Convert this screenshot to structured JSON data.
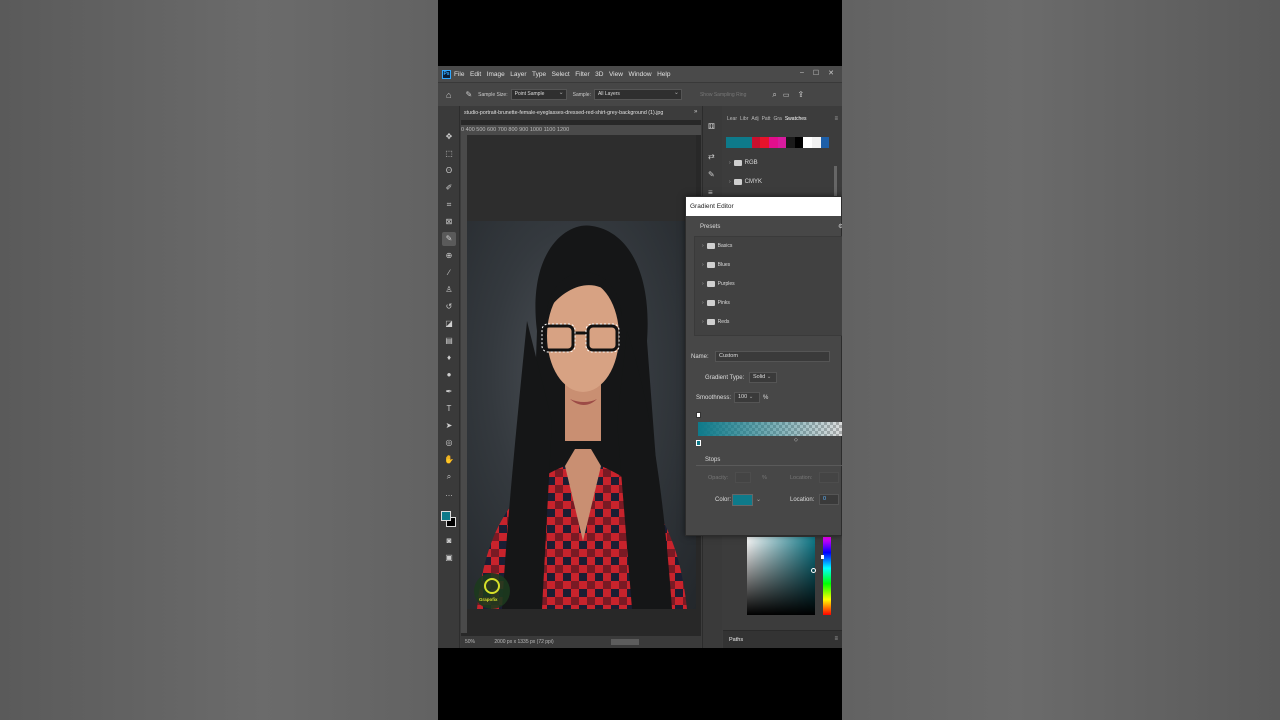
{
  "menu": {
    "items": [
      "File",
      "Edit",
      "Image",
      "Layer",
      "Type",
      "Select",
      "Filter",
      "3D",
      "View",
      "Window",
      "Help"
    ],
    "win_controls": [
      "–",
      "☐",
      "✕"
    ]
  },
  "options": {
    "sample_size_label": "Sample Size:",
    "sample_size_value": "Point Sample",
    "sample_label": "Sample:",
    "sample_value": "All Layers",
    "show_ring": "Show Sampling Ring"
  },
  "document": {
    "tab_title": "studio-portrait-brunette-female-eyeglasses-dressed-red-shirt-grey-background (1).jpg",
    "ruler": "0  400  500  600  700  800  900  1000  1100  1200",
    "zoom": "50%",
    "dimensions": "2000 px x 1335 px (72 ppi)",
    "watermark": "Grapofix"
  },
  "panel": {
    "tabs": [
      "Lear",
      "Libr",
      "Adj",
      "Patt",
      "Gra",
      "Swatches"
    ],
    "swatch_colors": [
      "#0e7a8a",
      "#0e7a8a",
      "#0e7a8a",
      "#c8102e",
      "#e8132b",
      "#e20e8c",
      "#d81b9e",
      "#1a1a1a",
      "#000000",
      "#ffffff",
      "#f2f2f2",
      "#1d5fa8"
    ],
    "groups": [
      "RGB",
      "CMYK"
    ],
    "paths_label": "Paths"
  },
  "gradient_editor": {
    "title": "Gradient Editor",
    "presets_label": "Presets",
    "presets": [
      "Basics",
      "Blues",
      "Purples",
      "Pinks",
      "Reds"
    ],
    "name_label": "Name:",
    "name_value": "Custom",
    "type_label": "Gradient Type:",
    "type_value": "Solid",
    "smooth_label": "Smoothness:",
    "smooth_value": "100",
    "smooth_unit": "%",
    "stops_label": "Stops",
    "opacity_label": "Opacity:",
    "opacity_unit": "%",
    "location_label": "Location:",
    "color_label": "Color:",
    "color_location_label": "Location:",
    "color_location_value": "0",
    "stop_color": "#0e7a8a"
  }
}
